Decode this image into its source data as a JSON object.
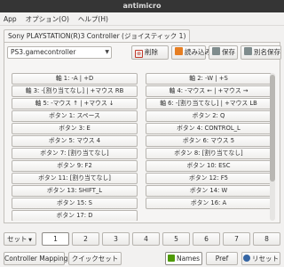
{
  "window": {
    "title": "antimicro"
  },
  "menu": {
    "items": [
      "App",
      "オプション(O)",
      "ヘルプ(H)"
    ]
  },
  "tab": {
    "label": "Sony PLAYSTATION(R)3 Controller (ジョイスティック 1)"
  },
  "profile": {
    "selected": "PS3.gamecontroller"
  },
  "toolbar": {
    "delete": "削除",
    "load": "読み込み",
    "save": "保存",
    "save_as": "別名保存"
  },
  "mappings": [
    [
      "軸 1: -A | +D",
      "軸 2: -W | +S"
    ],
    [
      "軸 3: -[割り当てなし] | +マウス RB",
      "軸 4: -マウス ← | +マウス →"
    ],
    [
      "軸 5: -マウス ↑ | +マウス ↓",
      "軸 6: -[割り当てなし] | +マウス LB"
    ],
    [
      "ボタン 1: スペース",
      "ボタン 2: Q"
    ],
    [
      "ボタン 3: E",
      "ボタン 4: CONTROL_L"
    ],
    [
      "ボタン 5: マウス 4",
      "ボタン 6: マウス 5"
    ],
    [
      "ボタン 7: [割り当てなし]",
      "ボタン 8: [割り当てなし]"
    ],
    [
      "ボタン 9: F2",
      "ボタン 10: ESC"
    ],
    [
      "ボタン 11: [割り当てなし]",
      "ボタン 12: F5"
    ],
    [
      "ボタン 13: SHIFT_L",
      "ボタン 14: W"
    ],
    [
      "ボタン 15: S",
      "ボタン 16: A"
    ],
    [
      "ボタン 17: D",
      ""
    ]
  ],
  "sets": {
    "label": "セット",
    "buttons": [
      "1",
      "2",
      "3",
      "4",
      "5",
      "6",
      "7",
      "8"
    ],
    "active": "1"
  },
  "bottom": {
    "controller_mapping": "Controller Mapping",
    "quick_set": "クイックセット",
    "names": "Names",
    "pref": "Pref",
    "reset": "リセット"
  },
  "colors": {
    "titlebar": "#353535",
    "delete_icon": "#c0392b",
    "load_icon": "#e67e22",
    "save_icon": "#7f8c8d",
    "names_icon": "#4e9a06",
    "reset_icon": "#3465a4"
  }
}
